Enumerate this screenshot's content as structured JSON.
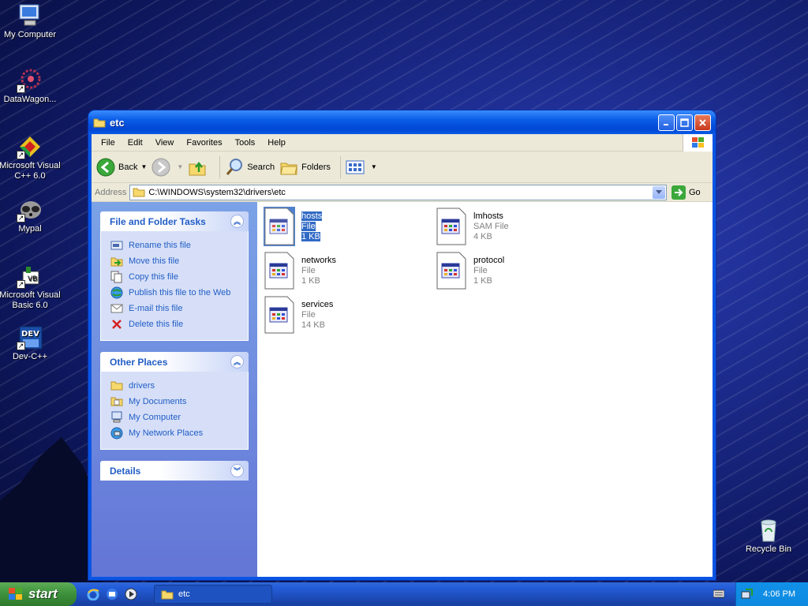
{
  "desktop": {
    "icons": [
      {
        "label": "My Computer"
      },
      {
        "label": "DataWagon..."
      },
      {
        "label": "Microsoft Visual C++ 6.0"
      },
      {
        "label": "Mypal"
      },
      {
        "label": "Microsoft Visual Basic 6.0"
      },
      {
        "label": "Dev-C++"
      },
      {
        "label": "Recycle Bin"
      }
    ]
  },
  "window": {
    "title": "etc",
    "menu": [
      "File",
      "Edit",
      "View",
      "Favorites",
      "Tools",
      "Help"
    ],
    "toolbar": {
      "back": "Back",
      "search": "Search",
      "folders": "Folders"
    },
    "address": {
      "label": "Address",
      "value": "C:\\WINDOWS\\system32\\drivers\\etc",
      "go": "Go"
    },
    "tasks": {
      "title": "File and Folder Tasks",
      "items": [
        "Rename this file",
        "Move this file",
        "Copy this file",
        "Publish this file to the Web",
        "E-mail this file",
        "Delete this file"
      ]
    },
    "places": {
      "title": "Other Places",
      "items": [
        "drivers",
        "My Documents",
        "My Computer",
        "My Network Places"
      ]
    },
    "details": {
      "title": "Details"
    },
    "files": [
      {
        "name": "hosts",
        "type": "File",
        "size": "1 KB",
        "selected": true
      },
      {
        "name": "lmhosts",
        "type": "SAM File",
        "size": "4 KB",
        "selected": false
      },
      {
        "name": "networks",
        "type": "File",
        "size": "1 KB",
        "selected": false
      },
      {
        "name": "protocol",
        "type": "File",
        "size": "1 KB",
        "selected": false
      },
      {
        "name": "services",
        "type": "File",
        "size": "14 KB",
        "selected": false
      }
    ]
  },
  "taskbar": {
    "start": "start",
    "task": "etc",
    "clock": "4:06 PM"
  }
}
